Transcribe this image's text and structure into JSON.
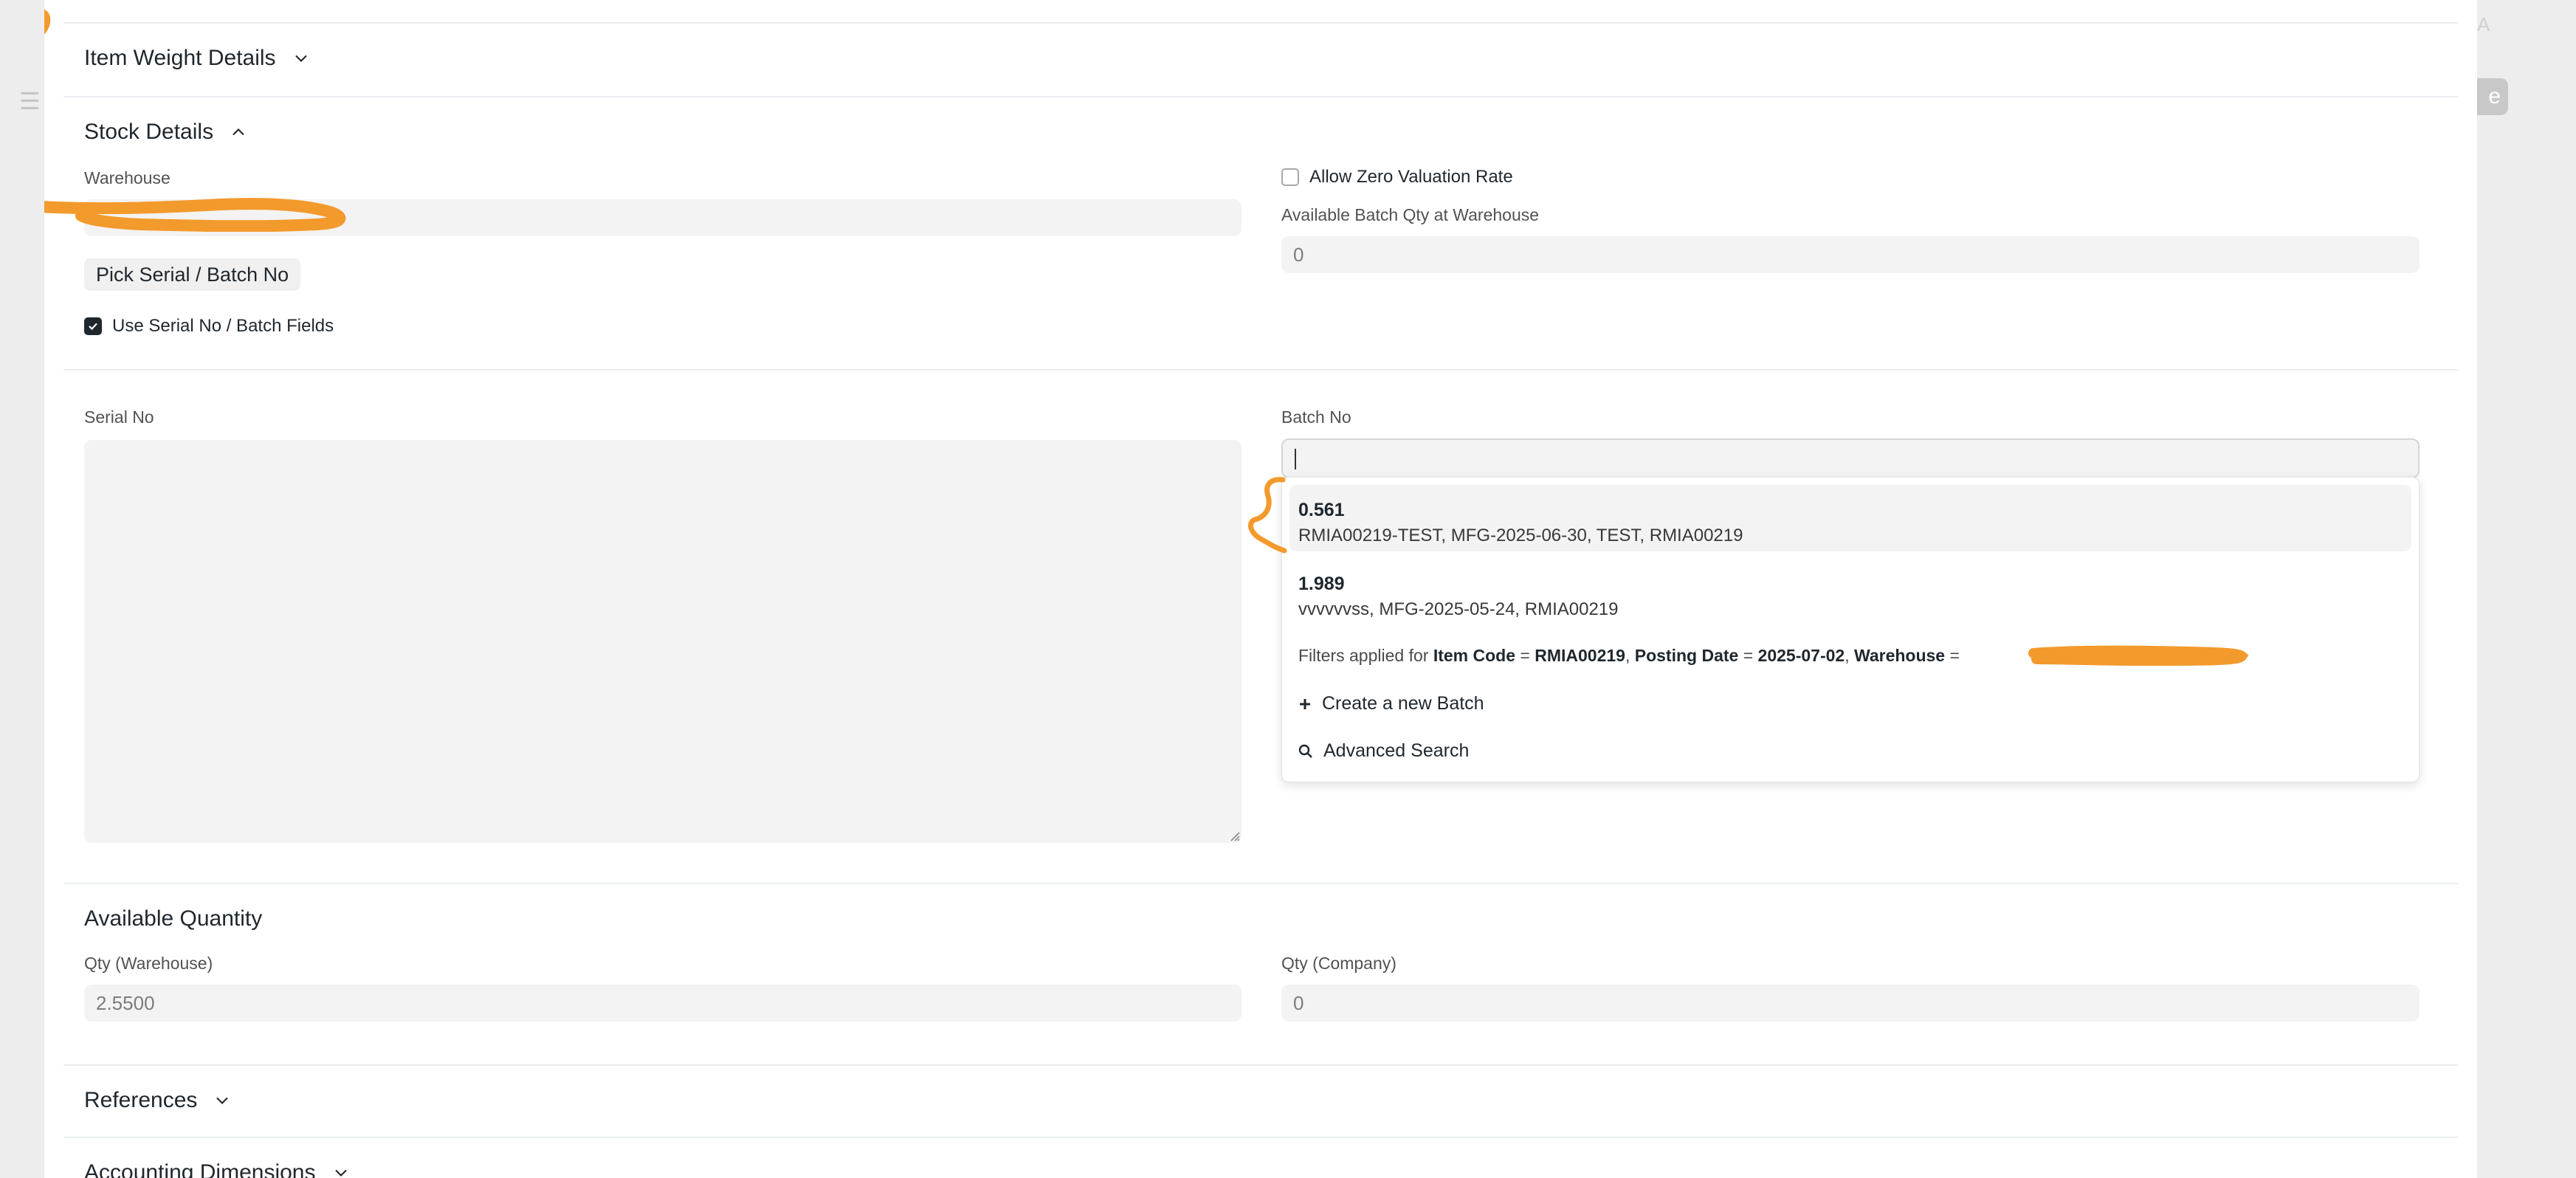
{
  "background": {
    "corner_text": "A",
    "save_partial": "e"
  },
  "sections": {
    "item_weight": {
      "title": "Item Weight Details",
      "icon": "chevron-down-icon"
    },
    "stock": {
      "title": "Stock Details",
      "icon": "chevron-up-icon"
    },
    "available_quantity": {
      "title": "Available Quantity"
    },
    "references": {
      "title": "References",
      "icon": "chevron-down-icon"
    },
    "accounting": {
      "title": "Accounting Dimensions",
      "icon": "chevron-down-icon"
    }
  },
  "stock": {
    "warehouse_label": "Warehouse",
    "warehouse_value": "",
    "pick_button": "Pick Serial / Batch No",
    "use_serial_label": "Use Serial No / Batch Fields",
    "use_serial_checked": true,
    "allow_zero_label": "Allow Zero Valuation Rate",
    "allow_zero_checked": false,
    "available_batch_label": "Available Batch Qty at Warehouse",
    "available_batch_value": "0"
  },
  "serial": {
    "serial_label": "Serial No",
    "serial_value": "",
    "batch_label": "Batch No",
    "batch_value": ""
  },
  "dropdown": {
    "items": [
      {
        "qty": "0.561",
        "desc": "RMIA00219-TEST, MFG-2025-06-30, TEST, RMIA00219"
      },
      {
        "qty": "1.989",
        "desc": "vvvvvvss, MFG-2025-05-24, RMIA00219"
      }
    ],
    "filter": {
      "prefix": "Filters applied for",
      "item_code_label": "Item Code",
      "item_code_value": "RMIA00219",
      "posting_date_label": "Posting Date",
      "posting_date_value": "2025-07-02",
      "warehouse_label": "Warehouse",
      "eq": "=",
      "sep": ","
    },
    "create_label": "Create a new Batch",
    "create_icon": "plus-icon",
    "search_label": "Advanced Search",
    "search_icon": "search-icon"
  },
  "available": {
    "qty_warehouse_label": "Qty (Warehouse)",
    "qty_warehouse_value": "2.5500",
    "qty_company_label": "Qty (Company)",
    "qty_company_value": "0"
  },
  "colors": {
    "annotation": "#f39a2c",
    "field_bg": "#f3f3f3",
    "text": "#1f272e"
  }
}
